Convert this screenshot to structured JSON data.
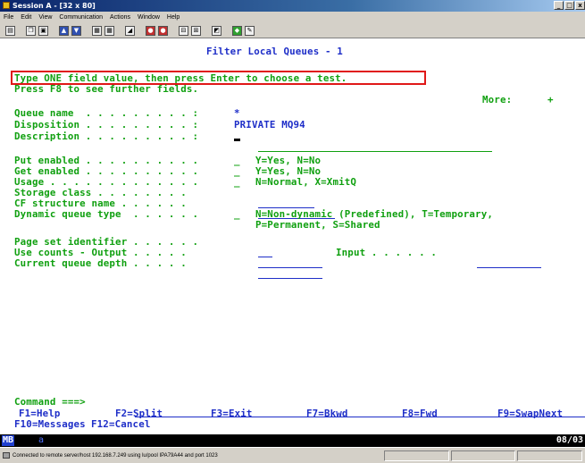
{
  "window": {
    "title": "Session A - [32 x 80]",
    "controls": [
      "_",
      "□",
      "x"
    ]
  },
  "menu": [
    "File",
    "Edit",
    "View",
    "Communication",
    "Actions",
    "Window",
    "Help"
  ],
  "toolbar_icons": [
    "print-screen",
    "copy",
    "paste",
    "send",
    "receive",
    "display-macro",
    "record-macro",
    "play-macro",
    "stop",
    "quick-connect",
    "disconnect",
    "keypad",
    "color-map",
    "help"
  ],
  "screen": {
    "title": "Filter Local Queues - 1",
    "instruction1": "Type ONE field value, then press Enter to choose a test.",
    "instruction2": "Press F8 to see further fields.",
    "more_label": "More:",
    "more_value": "+",
    "fields": {
      "queue_name": {
        "label": "Queue name  . . . . . . . . . :",
        "value": "*"
      },
      "disposition": {
        "label": "Disposition . . . . . . . . . :",
        "value": "PRIVATE MQ94"
      },
      "description": {
        "label": "Description . . . . . . . . . :",
        "value": ""
      },
      "put_enabled": {
        "label": "Put enabled . . . . . . . . . .",
        "value": "_",
        "hint": "Y=Yes, N=No"
      },
      "get_enabled": {
        "label": "Get enabled . . . . . . . . . .",
        "value": "_",
        "hint": "Y=Yes, N=No"
      },
      "usage": {
        "label": "Usage . . . . . . . . . . . . .",
        "value": "_",
        "hint": "N=Normal, X=XmitQ"
      },
      "storage_class": {
        "label": "Storage class . . . . . . . .",
        "value": ""
      },
      "cf_structure": {
        "label": "CF structure name . . . . . .",
        "value": ""
      },
      "dynamic_type": {
        "label": "Dynamic queue type  . . . . . .",
        "value": "_",
        "hint1": "N=Non-dynamic (Predefined), T=Temporary,",
        "hint2": "P=Permanent, S=Shared"
      },
      "page_set": {
        "label": "Page set identifier . . . . . .",
        "value": ""
      },
      "use_counts": {
        "label": "Use counts - Output . . . . .",
        "value": "",
        "input_label": "Input . . . . . .",
        "input_value": ""
      },
      "current_depth": {
        "label": "Current queue depth . . . . .",
        "value": ""
      }
    },
    "command_label": "Command ===>",
    "command_value": "",
    "fkeys_row1": [
      "F1=Help",
      "F2=Split",
      "F3=Exit",
      "F7=Bkwd",
      "F8=Fwd",
      "F9=SwapNext"
    ],
    "fkeys_row2": [
      "F10=Messages",
      "F12=Cancel"
    ]
  },
  "oia": {
    "indicator": "MB",
    "mode": "a",
    "cursor_pos": "08/03"
  },
  "status": "Connected to remote server/host 192.168.7.249 using lu/pool IPA79A44 and port 1023"
}
